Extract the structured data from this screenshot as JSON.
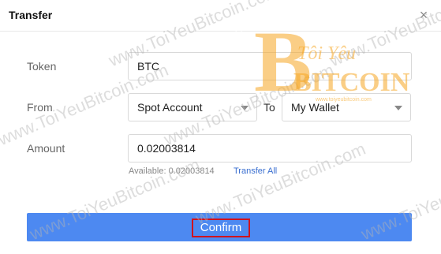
{
  "dialog": {
    "title": "Transfer",
    "close_icon": "close-icon"
  },
  "form": {
    "token": {
      "label": "Token",
      "value": "BTC"
    },
    "from": {
      "label": "From",
      "value": "Spot Account"
    },
    "to": {
      "label": "To",
      "value": "My Wallet"
    },
    "amount": {
      "label": "Amount",
      "value": "0.02003814",
      "available_label": "Available:",
      "available_value": "0.02003814",
      "transfer_all": "Transfer All"
    }
  },
  "actions": {
    "confirm": "Confirm"
  },
  "watermark": {
    "text": "www.ToiYeuBitcoin.com",
    "logo_line1": "Tôi Yêu",
    "logo_line2": "BITCOIN",
    "logo_small": "www.toiyeubitcoin.com",
    "logo_badge": "BITCOIN"
  },
  "colors": {
    "primary": "#4d89f1",
    "highlight": "#d0131e",
    "link": "#3a6fd0",
    "watermark_orange": "#f5a623"
  }
}
